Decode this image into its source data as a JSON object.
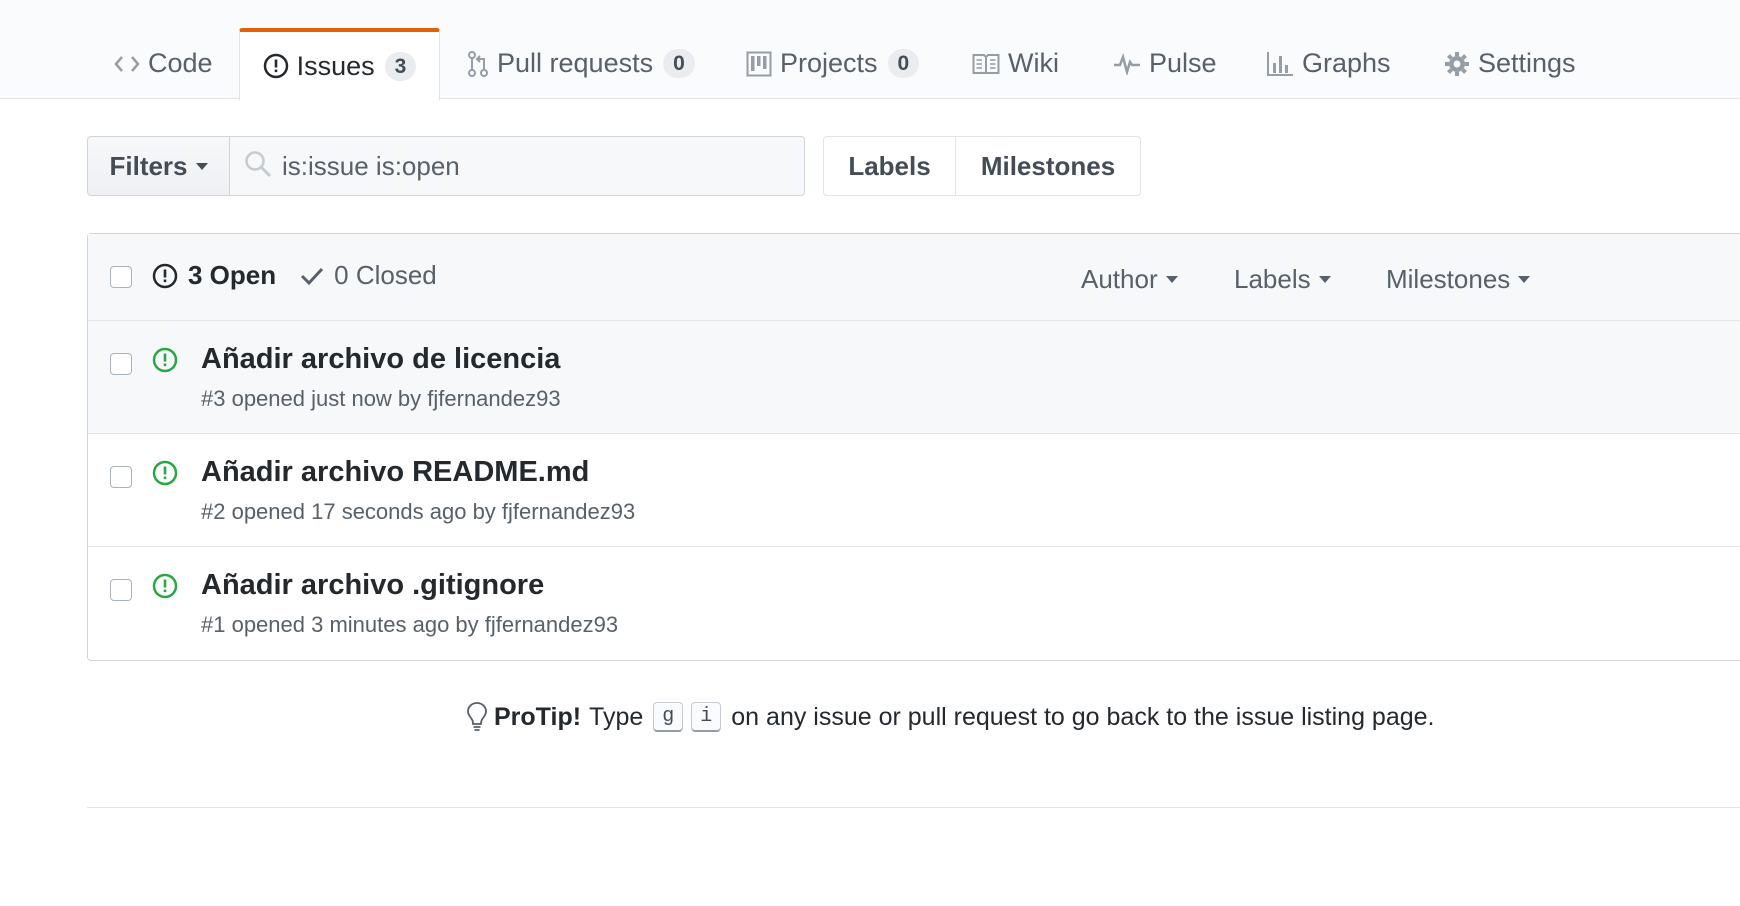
{
  "tabs": [
    {
      "label": "Code",
      "icon": "code-icon"
    },
    {
      "label": "Issues",
      "icon": "issue-opened-icon",
      "counter": "3",
      "selected": true
    },
    {
      "label": "Pull requests",
      "icon": "git-pull-request-icon",
      "counter": "0"
    },
    {
      "label": "Projects",
      "icon": "project-icon",
      "counter": "0"
    },
    {
      "label": "Wiki",
      "icon": "book-icon"
    },
    {
      "label": "Pulse",
      "icon": "pulse-icon"
    },
    {
      "label": "Graphs",
      "icon": "graph-icon"
    },
    {
      "label": "Settings",
      "icon": "gear-icon"
    }
  ],
  "subnav": {
    "filters_label": "Filters",
    "search_value": "is:issue is:open",
    "labels_label": "Labels",
    "milestones_label": "Milestones"
  },
  "list_header": {
    "open_label": "3 Open",
    "closed_label": "0 Closed",
    "author_label": "Author",
    "labels_label": "Labels",
    "milestones_label": "Milestones"
  },
  "issues": [
    {
      "title": "Añadir archivo de licencia",
      "meta": "#3 opened just now by fjfernandez93"
    },
    {
      "title": "Añadir archivo README.md",
      "meta": "#2 opened 17 seconds ago by fjfernandez93"
    },
    {
      "title": "Añadir archivo .gitignore",
      "meta": "#1 opened 3 minutes ago by fjfernandez93"
    }
  ],
  "protip": {
    "label": "ProTip!",
    "pre": "Type",
    "key1": "g",
    "key2": "i",
    "post": "on any issue or pull request to go back to the issue listing page."
  },
  "colors": {
    "accent_tab": "#e36209",
    "open_green": "#28a745",
    "muted": "#586069"
  }
}
